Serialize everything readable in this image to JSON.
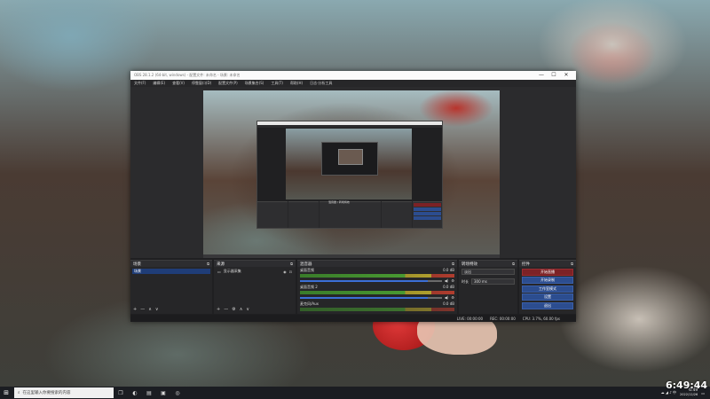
{
  "window": {
    "title": "OBS 28.1.2 (64-bit, windows) - 配置文件: 未命名 - 场景: 未命名",
    "minimize": "—",
    "maximize": "☐",
    "close": "✕"
  },
  "menu": [
    "文件(F)",
    "编辑(E)",
    "查看(V)",
    "停靠窗口(D)",
    "配置文件(P)",
    "场景集合(S)",
    "工具(T)",
    "帮助(H)",
    "日志·分析工具"
  ],
  "docks": {
    "scenes": {
      "title": "场景",
      "items": [
        "场景"
      ],
      "toolbar": [
        "+",
        "—",
        "∧",
        "∨"
      ]
    },
    "sources": {
      "title": "来源",
      "items": [
        {
          "name": "显示器采集"
        }
      ],
      "toolbar": [
        "+",
        "—",
        "⚙",
        "∧",
        "∨"
      ]
    },
    "mixer": {
      "title": "混音器",
      "channels": [
        {
          "name": "桌面音频",
          "db": "0.0 dB",
          "level": 0.9
        },
        {
          "name": "桌面音频 2",
          "db": "0.0 dB",
          "level": 0.9
        },
        {
          "name": "麦克风/Aux",
          "db": "0.0 dB",
          "level": 0.9
        }
      ]
    },
    "transitions": {
      "title": "转场特效",
      "type": "淡出",
      "duration_label": "时长",
      "duration": "300 ms"
    },
    "controls": {
      "title": "控件",
      "buttons": [
        "开始直播",
        "开始录制",
        "工作室模式",
        "设置",
        "退出"
      ]
    }
  },
  "nested": {
    "mixer_label": "混音器 / 转场特效"
  },
  "status": {
    "live": "LIVE: 00:00:00",
    "rec": "REC: 00:00:00",
    "cpu": "CPU: 3.7%, 60.00 fps"
  },
  "taskbar": {
    "search_placeholder": "在这里输入你要搜索的内容",
    "start_icon": "⊞",
    "tray_icons": "☁ ◢ ♪ 中",
    "time": "6:49",
    "date": "2022/12/26"
  },
  "overlay_time": "6:49:44",
  "colors": {
    "accent_blue": "#2c4d8f",
    "record_red": "#7c2226",
    "bg": "#1f1f21"
  }
}
